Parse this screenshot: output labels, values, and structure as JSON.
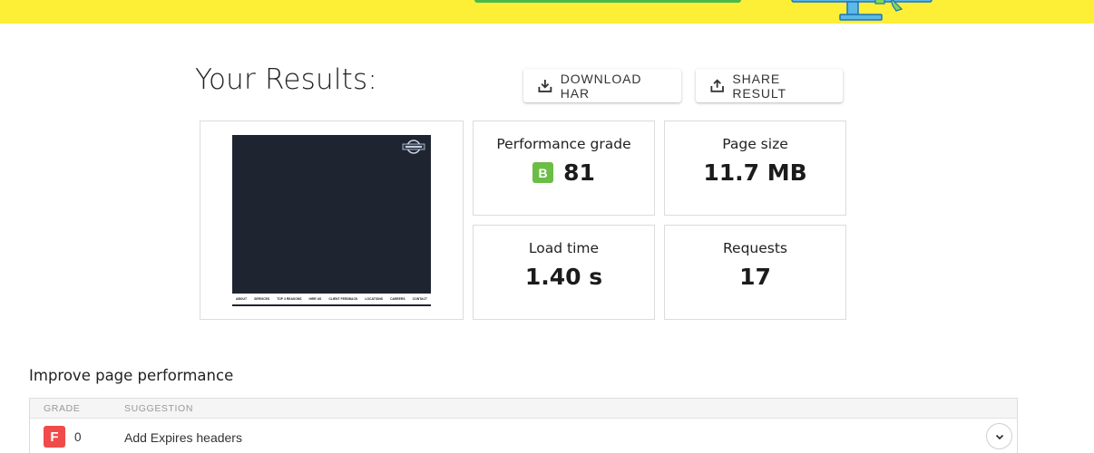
{
  "colors": {
    "banner": "#fdee36",
    "grade_b": "#6cbd45",
    "grade_f": "#f14a4a",
    "thumb_bg": "#1f2431"
  },
  "header": {
    "title": "Your Results:",
    "download_label": "DOWNLOAD HAR",
    "download_icon": "download-icon",
    "share_label": "SHARE RESULT",
    "share_icon": "share-icon"
  },
  "screenshot": {
    "nav_items": [
      "ABOUT",
      "SERVICES",
      "TOP 3 REASONS",
      "HIRE US",
      "CLIENT FEEDBACK",
      "LOCATIONS",
      "CAREERS",
      "CONTACT"
    ]
  },
  "metrics": {
    "performance": {
      "label": "Performance grade",
      "grade": "B",
      "value": "81"
    },
    "page_size": {
      "label": "Page size",
      "value": "11.7 MB"
    },
    "load_time": {
      "label": "Load time",
      "value": "1.40 s"
    },
    "requests": {
      "label": "Requests",
      "value": "17"
    }
  },
  "improve": {
    "title": "Improve page performance",
    "columns": {
      "grade": "GRADE",
      "suggestion": "SUGGESTION"
    },
    "rows": [
      {
        "grade": "F",
        "score": "0",
        "suggestion": "Add Expires headers"
      }
    ]
  }
}
